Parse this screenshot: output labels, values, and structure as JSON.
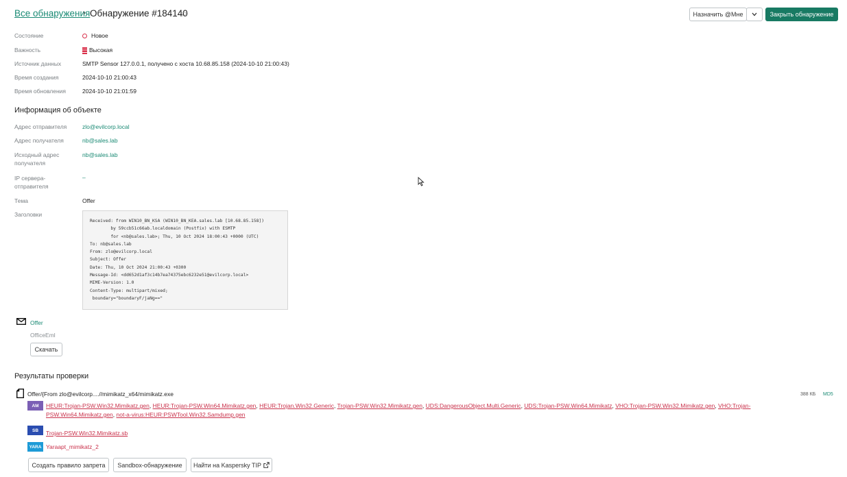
{
  "breadcrumb": {
    "parent": "Все обнаружения",
    "separator": "›",
    "title": "Обнаружение #184140"
  },
  "actions": {
    "assign": "Назначить @Мне",
    "close": "Закрыть обнаружение"
  },
  "fields": {
    "state_label": "Состояние",
    "state_value": "Новое",
    "severity_label": "Важность",
    "severity_value": "Высокая",
    "source_label": "Источник данных",
    "source_value": "SMTP Sensor 127.0.0.1, получено с хоста 10.68.85.158 (2024-10-10 21:00:43)",
    "created_label": "Время создания",
    "created_value": "2024-10-10 21:00:43",
    "updated_label": "Время обновления",
    "updated_value": "2024-10-10 21:01:59"
  },
  "object_info": {
    "title": "Информация об объекте",
    "sender_label": "Адрес отправителя",
    "sender_value": "zlo@evilcorp.local",
    "recipient_label": "Адрес получателя",
    "recipient_value": "nb@sales.lab",
    "orig_recipient_label": "Исходный адрес получателя",
    "orig_recipient_value": "nb@sales.lab",
    "ip_label": "IP сервера-отправителя",
    "ip_value": "–",
    "subject_label": "Тема",
    "subject_value": "Offer",
    "headers_label": "Заголовки",
    "headers_value": "Received: from WIN10_BN_KSA (WIN10_BN_KEA.sales.lab [10.68.85.158])\n        by 59ccb51c66ab.localdomain (Postfix) with ESMTP\n        for <nb@sales.lab>; Thu, 10 Oct 2024 18:00:43 +0000 (UTC)\nTo: nb@sales.lab\nFrom: zlo@evilcorp.local\nSubject: Offer\nDate: Thu, 10 Oct 2024 21:00:43 +0300\nMessage-Id: <dd652d1af3c14b7ea74375ebc6232e51@evilcorp.local>\nMIME-Version: 1.0\nContent-Type: multipart/mixed;\n boundary=\"boundaryF/jaNg==\""
  },
  "attachment": {
    "name": "Offer",
    "type": "OfficeEml",
    "download": "Скачать"
  },
  "results": {
    "title": "Результаты проверки",
    "file_path": "Offer/{From zlo@evilcorp....//mimikatz_x64/mimikatz.exe",
    "file_size": "388 КБ",
    "hash_type": "MD5",
    "am_badge": "AM",
    "am_line1": [
      "HEUR:Trojan-PSW.Win32.Mimikatz.gen",
      "HEUR:Trojan-PSW.Win64.Mimikatz.gen",
      "HEUR:Trojan.Win32.Generic",
      "Trojan-PSW.Win32.Mimikatz.gen",
      "UDS:DangerousObject.Multi.Generic",
      "UDS:Trojan-PSW.Win64.Mimikatz",
      "VHO:Trojan-PSW.Win32.Mimikatz.gen",
      "VHO:Trojan-"
    ],
    "am_line2": [
      "PSW.Win64.Mimikatz.gen",
      "not-a-virus:HEUR:PSWTool.Win32.Samdump.gen"
    ],
    "sb_badge": "SB",
    "sb_verdict": "Trojan-PSW.Win32.Mimikatz.sb",
    "yara_badge": "YARA",
    "yara_verdict": "Yaraapt_mimikatz_2"
  },
  "bottom_buttons": {
    "create_rule": "Создать правило запрета",
    "sandbox": "Sandbox-обнаружение",
    "tip": "Найти на Kaspersky TIP"
  },
  "colors": {
    "accent": "#187a63",
    "link": "#1a8a74",
    "danger": "#c9304a",
    "am": "#7b5fb5",
    "sb": "#2a4db0",
    "yara": "#1e9bd7"
  }
}
